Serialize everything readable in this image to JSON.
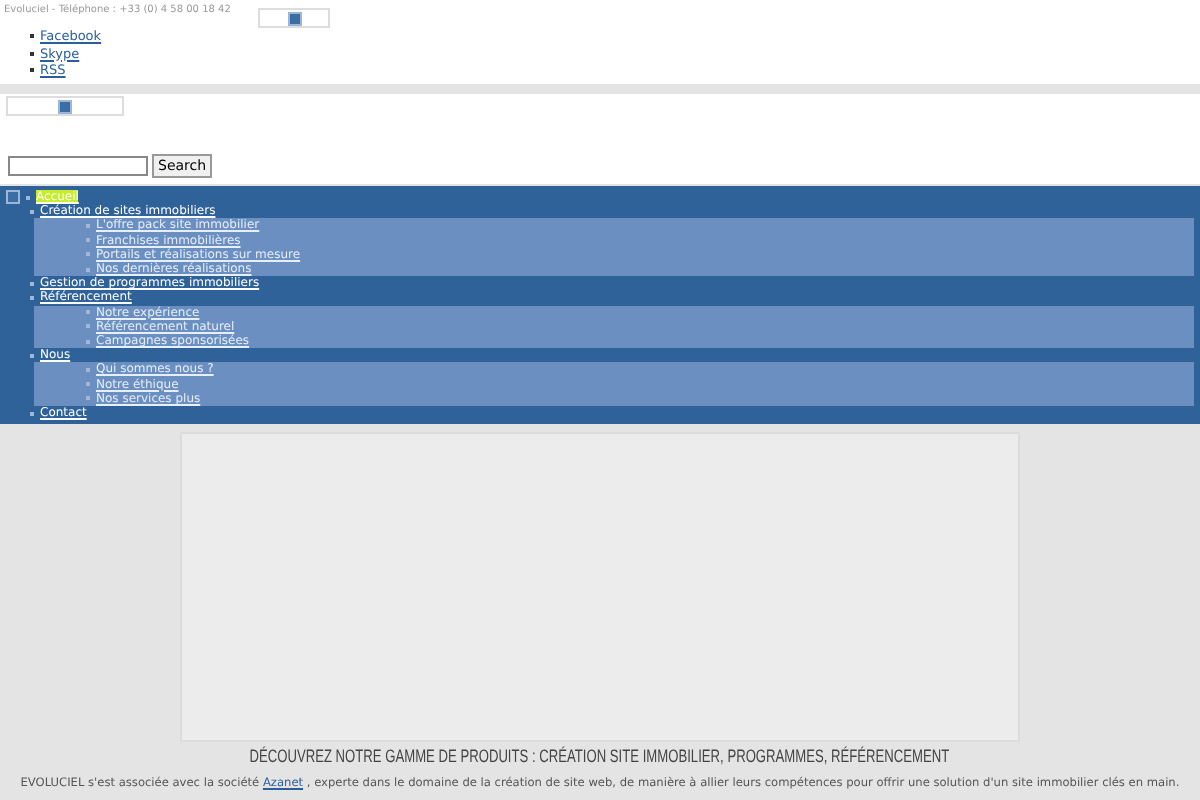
{
  "header": {
    "contact": "Evoluciel - Téléphone : +33 (0) 4 58 00 18 42",
    "social_links": [
      "Facebook",
      "Skype",
      "RSS"
    ]
  },
  "search": {
    "button": "Search"
  },
  "menu": [
    {
      "label": "Accueil",
      "selected": true
    },
    {
      "label": "Création de sites immobiliers",
      "selected": false,
      "children": [
        {
          "label": "L'offre pack site immobilier"
        },
        {
          "label": "Franchises immobilières"
        },
        {
          "label": "Portails et réalisations sur mesure"
        },
        {
          "label": "Nos dernières réalisations"
        }
      ]
    },
    {
      "label": "Gestion de programmes immobiliers",
      "selected": false
    },
    {
      "label": "Référencement",
      "selected": false,
      "children": [
        {
          "label": "Notre expérience"
        },
        {
          "label": "Référencement naturel"
        },
        {
          "label": "Campagnes sponsorisées"
        }
      ]
    },
    {
      "label": "Nous",
      "selected": false,
      "children": [
        {
          "label": "Qui sommes nous ?"
        },
        {
          "label": "Notre éthique"
        },
        {
          "label": "Nos services plus"
        }
      ]
    },
    {
      "label": "Contact",
      "selected": false
    }
  ],
  "content": {
    "heading": "DÉCOUVREZ NOTRE GAMME DE PRODUITS : CRÉATION SITE IMMOBILIER, PROGRAMMES, RÉFÉRENCEMENT",
    "intro": {
      "before": "EVOLUCIEL s'est associée avec la société",
      "link": "Azanet",
      "after": ", experte dans le domaine de la création de site web, de manière à  allier leurs compétences pour offrir une solution d'un site immobilier clés en main."
    }
  }
}
